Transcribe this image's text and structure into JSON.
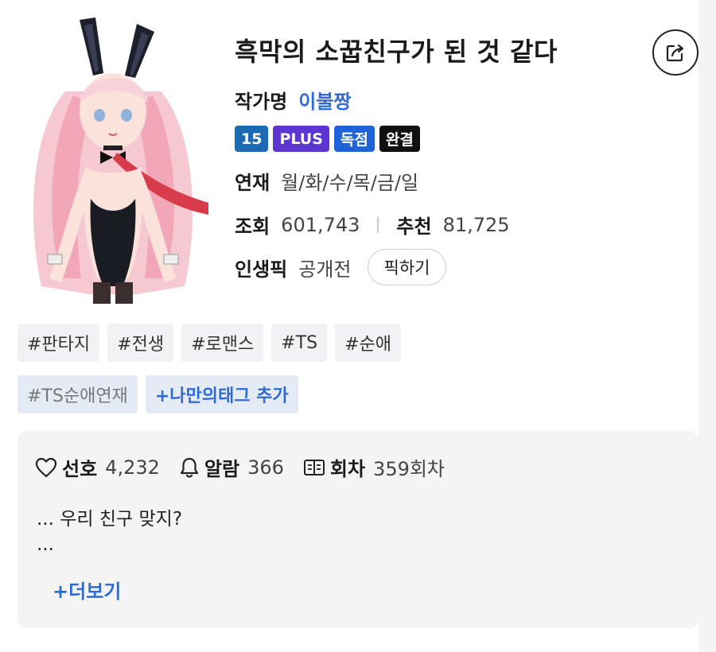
{
  "novel": {
    "title": "흑막의 소꿉친구가 된 것 같다",
    "author_label": "작가명",
    "author_name": "이불짱",
    "badges": [
      "15",
      "PLUS",
      "독점",
      "완결"
    ],
    "schedule_label": "연재",
    "schedule_value": "월/화/수/목/금/일",
    "views_label": "조회",
    "views_value": "601,743",
    "recommend_label": "추천",
    "recommend_value": "81,725",
    "pick_label": "인생픽",
    "pick_value": "공개전",
    "pick_button": "픽하기"
  },
  "tags": [
    "#판타지",
    "#전생",
    "#로맨스",
    "#TS",
    "#순애"
  ],
  "extra_tags": {
    "tag": "#TS순애연재",
    "add": "+나만의태그 추가"
  },
  "panel": {
    "favorite_label": "선호",
    "favorite_value": "4,232",
    "alarm_label": "알람",
    "alarm_value": "366",
    "episode_label": "회차",
    "episode_value": "359회차",
    "synopsis_line1": "... 우리 친구 맞지?",
    "synopsis_line2": "...",
    "more_label": "+더보기"
  },
  "icons": {
    "share": "share-icon",
    "heart": "heart-icon",
    "bell": "bell-icon",
    "episodes": "book-icon"
  },
  "colors": {
    "accent_blue": "#2f6bd6",
    "badge_age": "#1c6ab3",
    "badge_plus": "#5d35d2",
    "badge_exclusive": "#1f63db",
    "badge_complete": "#111111"
  }
}
